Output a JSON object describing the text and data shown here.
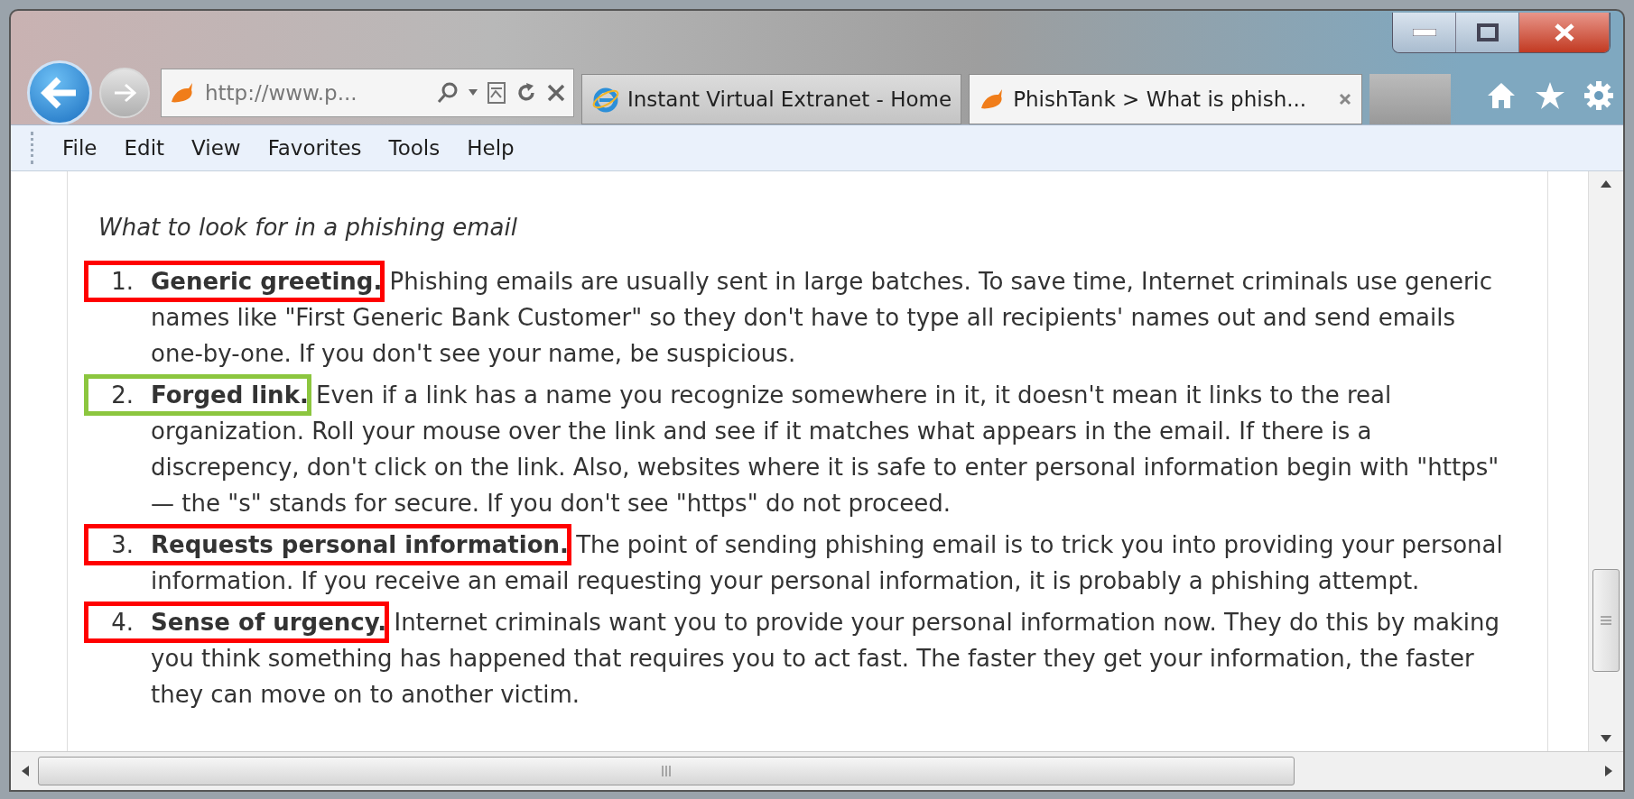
{
  "browser": {
    "address": "http://www.p...",
    "tabs": [
      {
        "title": "Instant Virtual Extranet - Home",
        "kind": "ie",
        "selected": false
      },
      {
        "title": "PhishTank > What is phish...",
        "kind": "fish",
        "selected": true
      }
    ]
  },
  "menu": [
    "File",
    "Edit",
    "View",
    "Favorites",
    "Tools",
    "Help"
  ],
  "page": {
    "heading": "What to look for in a phishing email",
    "items": [
      {
        "number": "1.",
        "text": "**Generic greeting.** Phishing emails are usually sent in large batches. To save time, Internet criminals use generic names like \"First Generic Bank Customer\" so they don't have to type all recipients' names out and send emails one-by-one. If you don't see your name, be suspicious.",
        "color": "#ff0000"
      },
      {
        "number": "2.",
        "text": "**Forged link.** Even if a link has a name you recognize somewhere in it, it doesn't mean it links to the real organization. Roll your mouse over the link and see if it matches what appears in the email. If there is a discrepency, don't click on the link. Also, websites where it is safe to enter personal information begin with \"https\" — the \"s\" stands for secure. If you don't see \"https\" do not proceed.",
        "color": "#8cc63f"
      },
      {
        "number": "3.",
        "text": "**Requests personal information.** The point of sending phishing email is to trick you into providing your personal information. If you receive an email requesting your personal information, it is probably a phishing attempt.",
        "color": "#ff0000"
      },
      {
        "number": "4.",
        "text": "**Sense of urgency.** Internet criminals want you to provide your personal information now. They do this by making you think something has happened that requires you to act fast. The faster they get your information, the faster they can move on to another victim.",
        "color": "#ff0000"
      }
    ]
  }
}
